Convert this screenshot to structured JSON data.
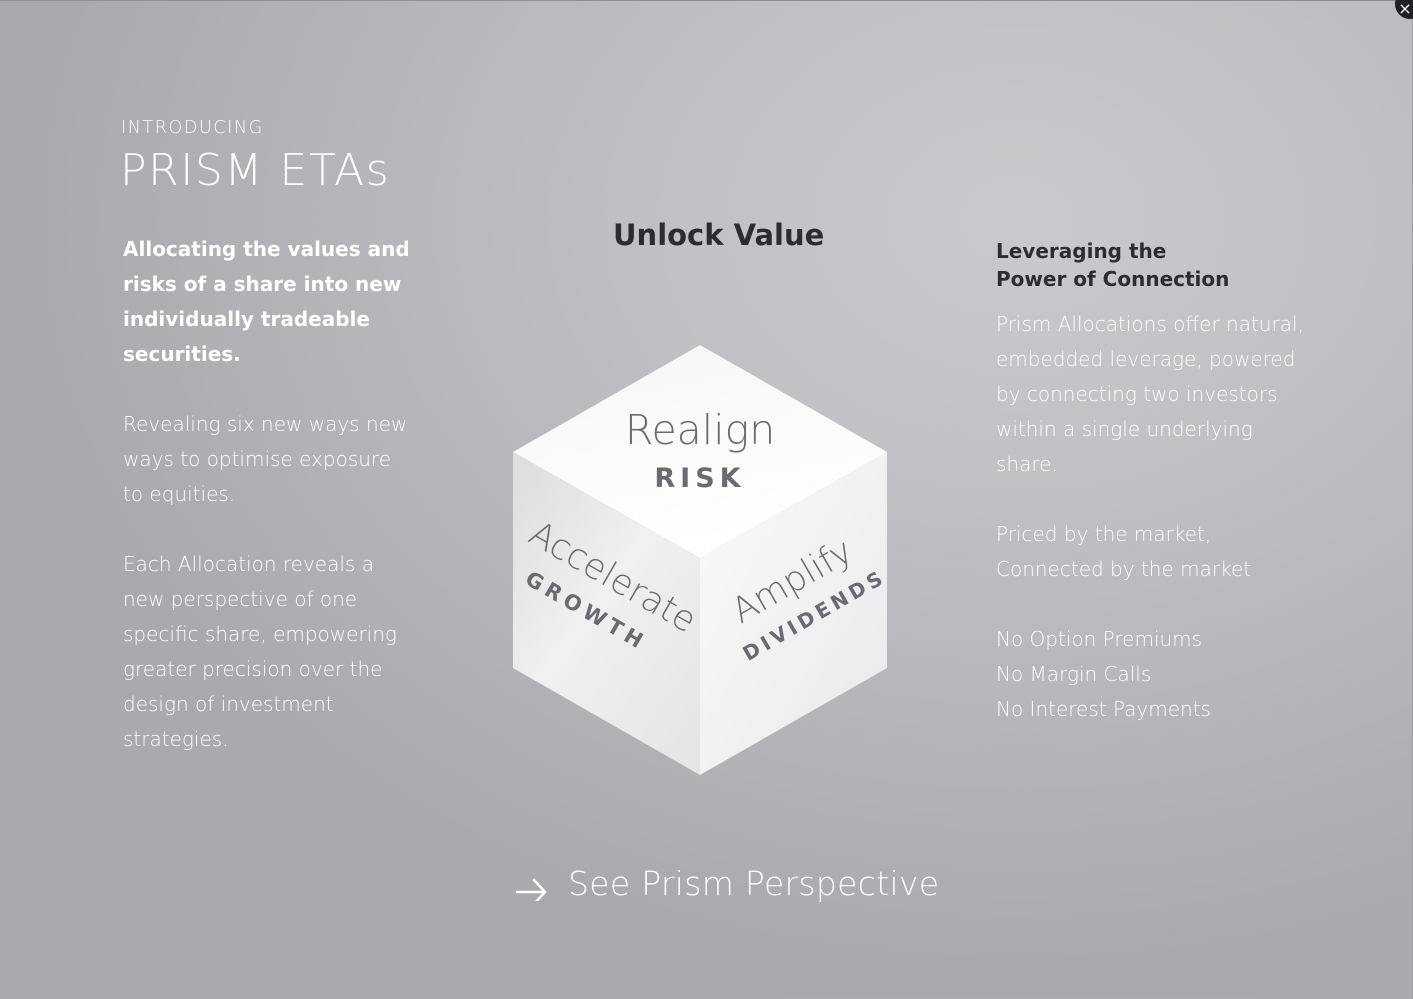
{
  "modal": {
    "close_label": "×"
  },
  "intro": {
    "kicker": "INTRODUCING",
    "title": "PRISM ETAs"
  },
  "left_column": {
    "lead": "Allocating the values and risks of a share into new individually tradeable securities.",
    "paragraph_1": "Revealing six new ways new ways to optimise exposure to equities.",
    "paragraph_2": "Each Allocation reveals a new perspective of one specific share, empowering greater precision over the design of investment strategies."
  },
  "center": {
    "title": "Unlock Value",
    "cube": {
      "top_verb": "Realign",
      "top_noun": "RISK",
      "left_verb": "Accelerate",
      "left_noun": "GROWTH",
      "right_verb": "Amplify",
      "right_noun": "DIVIDENDS"
    }
  },
  "right_column": {
    "heading_line_1": "Leveraging the",
    "heading_line_2": "Power of Connection",
    "paragraph_1": "Prism Allocations offer natural, embedded leverage, powered by connecting two investors within a single underlying share.",
    "paragraph_2_line_1": "Priced by the market,",
    "paragraph_2_line_2": "Connected by the market",
    "benefits": [
      "No Option Premiums",
      "No Margin Calls",
      "No Interest Payments"
    ]
  },
  "cta": {
    "label": "See Prism Perspective",
    "icon": "arrow-right-icon"
  },
  "colors": {
    "text_light": "#ffffff",
    "text_dark": "#2c2d33",
    "cube_text": "#6a6b71",
    "close_button": "#1f2023"
  }
}
